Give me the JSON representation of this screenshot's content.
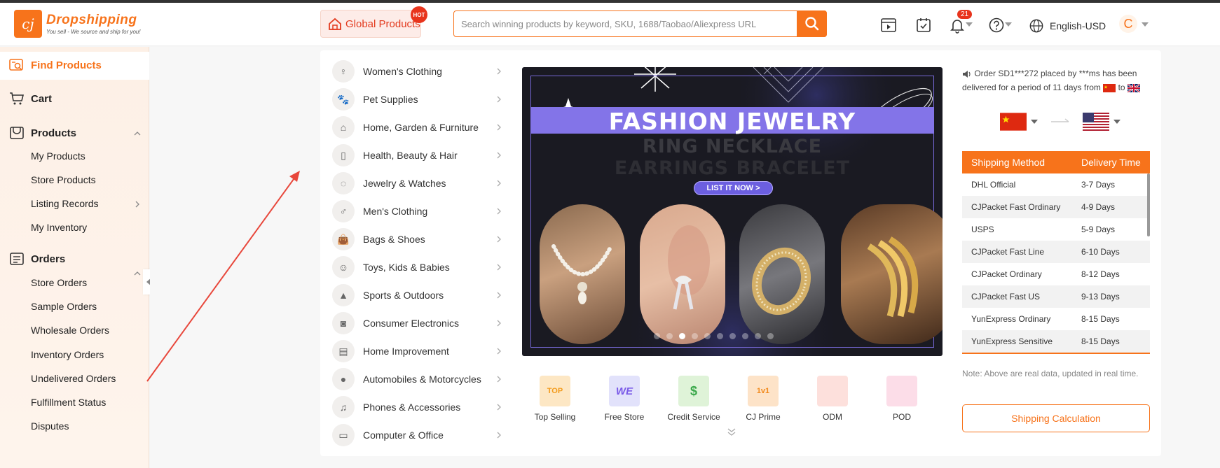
{
  "header": {
    "logo_name": "Dropshipping",
    "logo_tagline": "You sell - We source and ship for you!",
    "global_products_label": "Global Products",
    "hot_badge": "HOT",
    "search_placeholder": "Search winning products by keyword, SKU, 1688/Taobao/Aliexpress URL",
    "notification_count": "21",
    "language": "English-USD",
    "avatar_initial": "C"
  },
  "sidebar": {
    "find_products": "Find Products",
    "cart": "Cart",
    "products": "Products",
    "products_items": [
      "My Products",
      "Store Products",
      "Listing Records",
      "My Inventory"
    ],
    "orders": "Orders",
    "orders_items": [
      "Store Orders",
      "Sample Orders",
      "Wholesale Orders",
      "Inventory Orders",
      "Undelivered Orders",
      "Fulfillment Status",
      "Disputes"
    ]
  },
  "categories": [
    "Women's Clothing",
    "Pet Supplies",
    "Home, Garden & Furniture",
    "Health, Beauty & Hair",
    "Jewelry & Watches",
    "Men's Clothing",
    "Bags & Shoes",
    "Toys, Kids & Babies",
    "Sports & Outdoors",
    "Consumer Electronics",
    "Home Improvement",
    "Automobiles & Motorcycles",
    "Phones & Accessories",
    "Computer & Office"
  ],
  "banner": {
    "title": "FASHION JEWELRY",
    "subtitle_1": "RING NECKLACE",
    "subtitle_2": "EARRINGS BRACELET",
    "cta": "LIST IT NOW >",
    "slide_count": 10,
    "active_slide": 3
  },
  "quick_links": [
    "Top Selling",
    "Free Store",
    "Credit Service",
    "CJ Prime",
    "ODM",
    "POD"
  ],
  "quick_link_icon_text": [
    "TOP",
    "WE",
    "$",
    "1v1",
    "",
    ""
  ],
  "shipping": {
    "notice_line1": "Order SD1***272 placed by ***ms has been",
    "notice_line2_a": "delivered for a period of 11 days from",
    "notice_line2_b": "to",
    "col_method": "Shipping Method",
    "col_time": "Delivery Time",
    "rows": [
      {
        "method": "DHL Official",
        "time": "3-7 Days"
      },
      {
        "method": "CJPacket Fast Ordinary",
        "time": "4-9 Days"
      },
      {
        "method": "USPS",
        "time": "5-9 Days"
      },
      {
        "method": "CJPacket Fast Line",
        "time": "6-10 Days"
      },
      {
        "method": "CJPacket Ordinary",
        "time": "8-12 Days"
      },
      {
        "method": "CJPacket Fast US",
        "time": "9-13 Days"
      },
      {
        "method": "YunExpress Ordinary",
        "time": "8-15 Days"
      },
      {
        "method": "YunExpress Sensitive",
        "time": "8-15 Days"
      }
    ],
    "note": "Note: Above are real data, updated in real time.",
    "calc_button": "Shipping Calculation"
  },
  "colors": {
    "accent": "#f7731b",
    "hot": "#e8341c",
    "banner_purple": "#8374e8"
  }
}
